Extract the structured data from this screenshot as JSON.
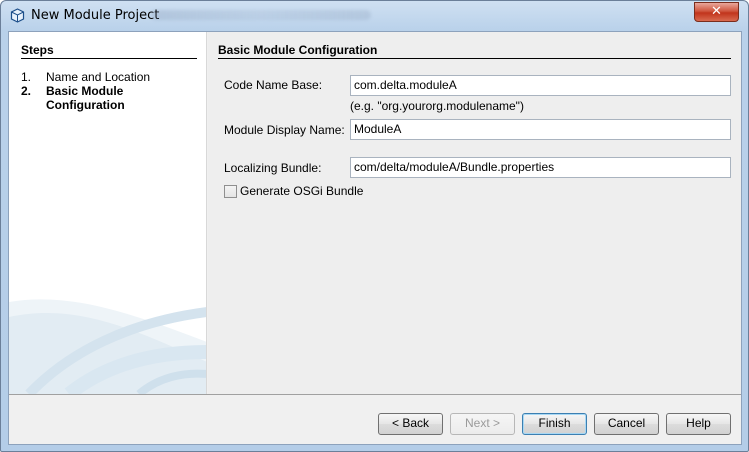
{
  "window": {
    "title": "New Module Project",
    "close_glyph": "✕"
  },
  "steps": {
    "title": "Steps",
    "items": [
      {
        "number": "1.",
        "label": "Name and Location"
      },
      {
        "number": "2.",
        "label": "Basic Module Configuration"
      }
    ],
    "current_index": 2
  },
  "form": {
    "section_title": "Basic Module Configuration",
    "code_name_base": {
      "label": "Code Name Base:",
      "value": "com.delta.moduleA"
    },
    "code_name_hint": "(e.g. \"org.yourorg.modulename\")",
    "display_name": {
      "label": "Module Display Name:",
      "value": "ModuleA"
    },
    "localizing_bundle": {
      "label": "Localizing Bundle:",
      "value": "com/delta/moduleA/Bundle.properties"
    },
    "osgi_checkbox": {
      "label": "Generate OSGi Bundle",
      "checked": false
    }
  },
  "buttons": {
    "back": "< Back",
    "next": "Next >",
    "finish": "Finish",
    "cancel": "Cancel",
    "help": "Help"
  },
  "icons": {
    "title": "netbeans-cube-icon",
    "close": "close-icon",
    "decoration": "swoosh-watermark"
  }
}
